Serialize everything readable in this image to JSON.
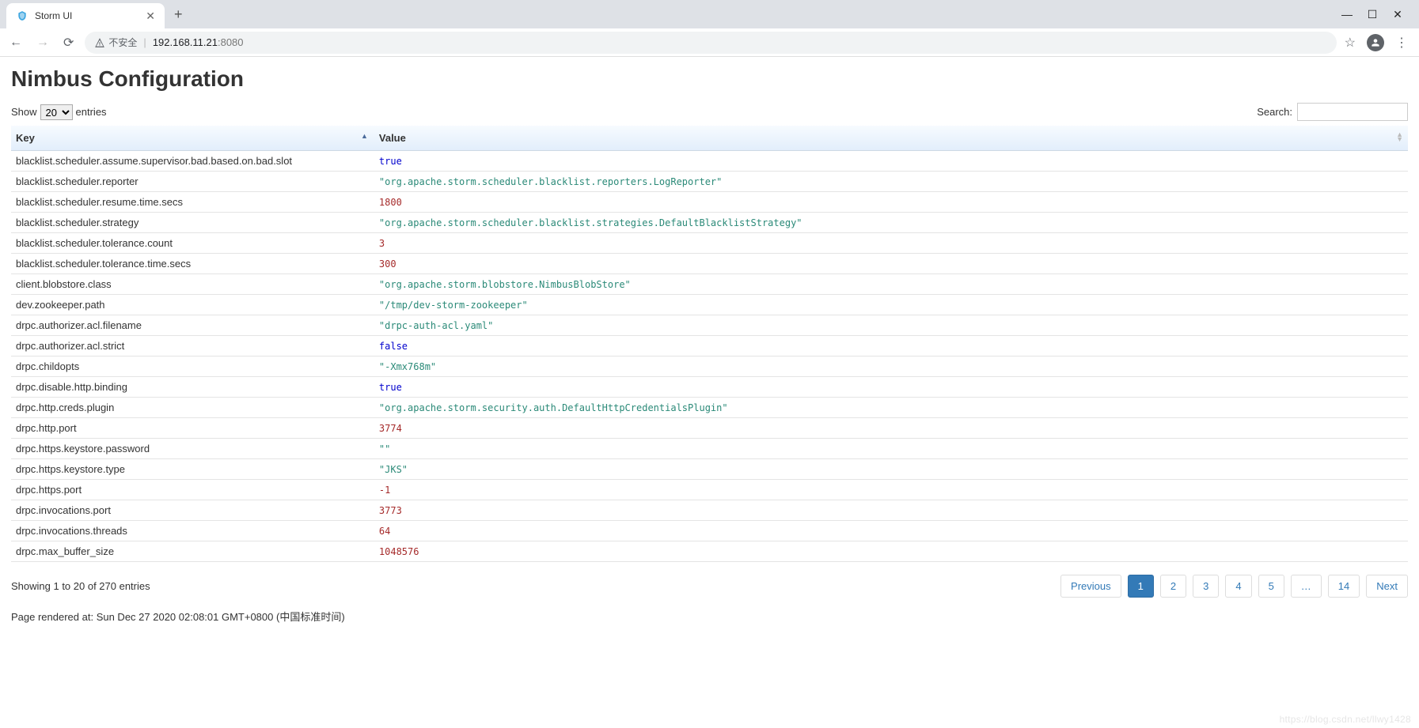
{
  "browser": {
    "tab_title": "Storm UI",
    "url_status": "不安全",
    "url_host": "192.168.11.21",
    "url_port": ":8080",
    "window_minimize": "—",
    "window_maximize": "☐",
    "window_close": "✕",
    "tab_close": "✕",
    "tab_new": "+",
    "separator": "|"
  },
  "page_title": "Nimbus Configuration",
  "controls": {
    "show_label": "Show",
    "entries_label": "entries",
    "per_page": "20",
    "search_label": "Search:"
  },
  "columns": {
    "key": "Key",
    "value": "Value"
  },
  "rows": [
    {
      "key": "blacklist.scheduler.assume.supervisor.bad.based.on.bad.slot",
      "value": "true",
      "type": "bool"
    },
    {
      "key": "blacklist.scheduler.reporter",
      "value": "\"org.apache.storm.scheduler.blacklist.reporters.LogReporter\"",
      "type": "string"
    },
    {
      "key": "blacklist.scheduler.resume.time.secs",
      "value": "1800",
      "type": "number"
    },
    {
      "key": "blacklist.scheduler.strategy",
      "value": "\"org.apache.storm.scheduler.blacklist.strategies.DefaultBlacklistStrategy\"",
      "type": "string"
    },
    {
      "key": "blacklist.scheduler.tolerance.count",
      "value": "3",
      "type": "number"
    },
    {
      "key": "blacklist.scheduler.tolerance.time.secs",
      "value": "300",
      "type": "number"
    },
    {
      "key": "client.blobstore.class",
      "value": "\"org.apache.storm.blobstore.NimbusBlobStore\"",
      "type": "string"
    },
    {
      "key": "dev.zookeeper.path",
      "value": "\"/tmp/dev-storm-zookeeper\"",
      "type": "string"
    },
    {
      "key": "drpc.authorizer.acl.filename",
      "value": "\"drpc-auth-acl.yaml\"",
      "type": "string"
    },
    {
      "key": "drpc.authorizer.acl.strict",
      "value": "false",
      "type": "bool"
    },
    {
      "key": "drpc.childopts",
      "value": "\"-Xmx768m\"",
      "type": "string"
    },
    {
      "key": "drpc.disable.http.binding",
      "value": "true",
      "type": "bool"
    },
    {
      "key": "drpc.http.creds.plugin",
      "value": "\"org.apache.storm.security.auth.DefaultHttpCredentialsPlugin\"",
      "type": "string"
    },
    {
      "key": "drpc.http.port",
      "value": "3774",
      "type": "number"
    },
    {
      "key": "drpc.https.keystore.password",
      "value": "\"\"",
      "type": "string"
    },
    {
      "key": "drpc.https.keystore.type",
      "value": "\"JKS\"",
      "type": "string"
    },
    {
      "key": "drpc.https.port",
      "value": "-1",
      "type": "number"
    },
    {
      "key": "drpc.invocations.port",
      "value": "3773",
      "type": "number"
    },
    {
      "key": "drpc.invocations.threads",
      "value": "64",
      "type": "number"
    },
    {
      "key": "drpc.max_buffer_size",
      "value": "1048576",
      "type": "number"
    }
  ],
  "footer_info": "Showing 1 to 20 of 270 entries",
  "pagination": {
    "previous": "Previous",
    "pages": [
      "1",
      "2",
      "3",
      "4",
      "5",
      "…",
      "14"
    ],
    "next": "Next",
    "active": "1"
  },
  "render_time": "Page rendered at: Sun Dec 27 2020 02:08:01 GMT+0800 (中国标准时间)",
  "watermark": "https://blog.csdn.net/llwy1428"
}
